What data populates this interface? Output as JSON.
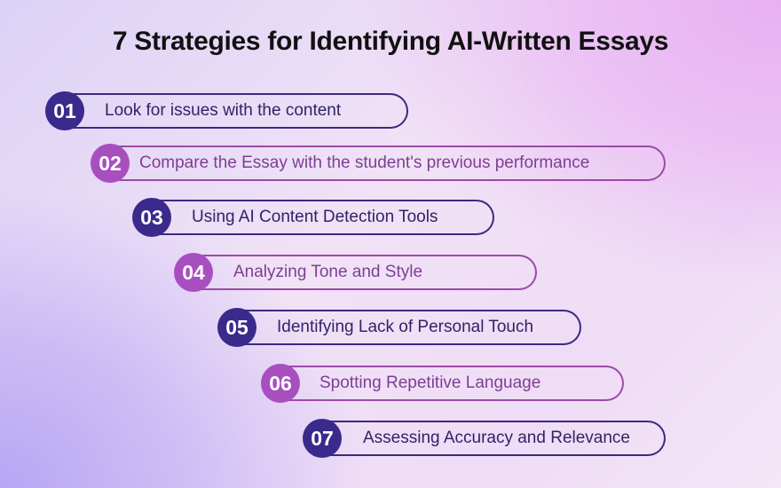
{
  "title": "7 Strategies for Identifying AI-Written Essays",
  "colors": {
    "dark_badge": "#3a2a8c",
    "magenta_badge": "#a84fc0",
    "dark_text": "#2f2466",
    "magenta_text": "#7d3f92"
  },
  "strategies": [
    {
      "number": "01",
      "label": "Look for issues with the content",
      "style": "dark"
    },
    {
      "number": "02",
      "label": "Compare the Essay with the student's previous performance",
      "style": "magenta"
    },
    {
      "number": "03",
      "label": "Using AI Content Detection Tools",
      "style": "dark"
    },
    {
      "number": "04",
      "label": "Analyzing Tone and Style",
      "style": "magenta"
    },
    {
      "number": "05",
      "label": "Identifying Lack of Personal Touch",
      "style": "dark"
    },
    {
      "number": "06",
      "label": "Spotting Repetitive Language",
      "style": "magenta"
    },
    {
      "number": "07",
      "label": "Assessing Accuracy and Relevance",
      "style": "dark"
    }
  ]
}
